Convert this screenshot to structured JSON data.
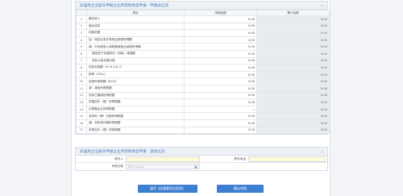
{
  "section1": {
    "title": "非居民企业股东申报企业所得税季度申报 - 申报表信息",
    "headers": [
      "",
      "项目",
      "本期金额",
      "累计金额"
    ],
    "rows": [
      {
        "seq": "1",
        "label": "营业收入",
        "indent": 0,
        "cur": "0.00",
        "cum": "0.00"
      },
      {
        "seq": "2",
        "label": "营业成本",
        "indent": 0,
        "cur": "0.00",
        "cum": "0.00"
      },
      {
        "seq": "3",
        "label": "利润总额",
        "indent": 0,
        "cur": "0.00",
        "cum": "0.00"
      },
      {
        "seq": "4",
        "label": "加：特定业务计算的应纳税所得额",
        "indent": 0,
        "cur": "0.00",
        "cum": "0.00"
      },
      {
        "seq": "5",
        "label": "减：不征税收入和税基减免应纳税所得额",
        "indent": 0,
        "cur": "0.00",
        "cum": "0.00"
      },
      {
        "seq": "6",
        "label": "固定资产加速折旧（扣除）调减额",
        "indent": 1,
        "cur": "0.00",
        "cum": "0.00"
      },
      {
        "seq": "7",
        "label": "弥补以前年度亏损",
        "indent": 1,
        "cur": "0.00",
        "cum": "0.00"
      },
      {
        "seq": "8",
        "label": "实际利润额（3+4-5-6-7）",
        "indent": 0,
        "cur": "0.00",
        "cum": "0.00"
      },
      {
        "seq": "9",
        "label": "税率（25%）",
        "indent": 0,
        "cur": "0.00",
        "cum": "0.00"
      },
      {
        "seq": "10",
        "label": "应纳所得税额（8×9）",
        "indent": 0,
        "cur": "0.00",
        "cum": "0.00"
      },
      {
        "seq": "11",
        "label": "减：减免所得税额",
        "indent": 0,
        "cur": "0.00",
        "cum": "0.00"
      },
      {
        "seq": "12",
        "label": "实际已缴纳所得税额",
        "indent": 0,
        "cur": "0.00",
        "cum": "0.00"
      },
      {
        "seq": "13",
        "label": "本期应补（退）所得税额",
        "indent": 0,
        "cur": "0.00",
        "cum": "0.00"
      },
      {
        "seq": "14",
        "label": "已预缴企业所得税额",
        "indent": 0,
        "cur": "",
        "cum": "0.00",
        "dropdown": true
      },
      {
        "seq": "15",
        "label": "总机构（跨）分配所得税额",
        "indent": 0,
        "cur": "0.00",
        "cum": "0.00"
      },
      {
        "seq": "16",
        "label": "减：总机构分摊所得税额",
        "indent": 0,
        "cur": "0.00",
        "cum": "0.00"
      },
      {
        "seq": "17",
        "label": "本季应补（退）所得税额",
        "indent": 0,
        "cur": "0.00",
        "cum": "0.00"
      }
    ]
  },
  "section2": {
    "title": "非居民企业股东申报企业所得税季度申报 - 其他信息",
    "fields": {
      "name_label": "联系人",
      "phone_label": "联系电话",
      "date_label": "申报日期",
      "date_value": "2017-01-01"
    }
  },
  "buttons": {
    "fill": "填写《优惠事项信息表》",
    "confirm": "确认申报"
  },
  "icons": {
    "collapse": "chevron-up-icon",
    "dropdown": "chevron-down-icon",
    "calendar": "calendar-icon"
  }
}
